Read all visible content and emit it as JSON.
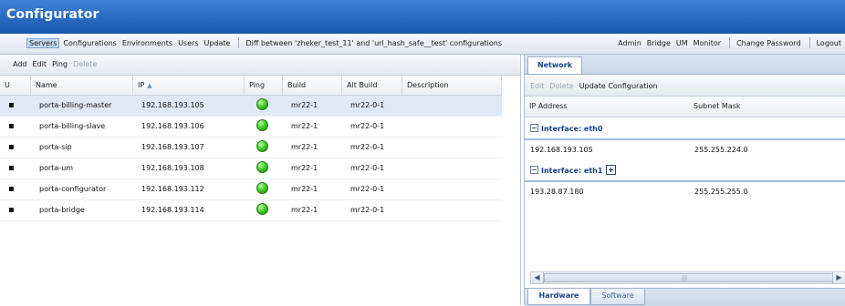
{
  "app": {
    "title": "Configurator"
  },
  "menu": {
    "left": [
      "Servers",
      "Configurations",
      "Environments",
      "Users",
      "Update"
    ],
    "diff": "Diff between 'zheker_test_11' and 'url_hash_safe__test' configurations",
    "right_group": [
      "Admin",
      "Bridge",
      "UM",
      "Monitor"
    ],
    "change_password": "Change Password",
    "logout": "Logout"
  },
  "servers_toolbar": {
    "add": "Add",
    "edit": "Edit",
    "ping": "Ping",
    "delete": "Delete"
  },
  "servers_table": {
    "headers": [
      "U",
      "Name",
      "IP",
      "Ping",
      "Build",
      "Alt Build",
      "Description"
    ],
    "rows": [
      {
        "u": "▪",
        "name": "porta-billing-master",
        "ip": "192.168.193.105",
        "ping": "ok",
        "build": "mr22-1",
        "alt_build": "mr22-0-1",
        "description": ""
      },
      {
        "u": "▪",
        "name": "porta-billing-slave",
        "ip": "192.168.193.106",
        "ping": "ok",
        "build": "mr22-1",
        "alt_build": "mr22-0-1",
        "description": ""
      },
      {
        "u": "▪",
        "name": "porta-sip",
        "ip": "192.168.193.107",
        "ping": "ok",
        "build": "mr22-1",
        "alt_build": "mr22-0-1",
        "description": ""
      },
      {
        "u": "▪",
        "name": "porta-um",
        "ip": "192.168.193.108",
        "ping": "ok",
        "build": "mr22-1",
        "alt_build": "mr22-0-1",
        "description": ""
      },
      {
        "u": "▪",
        "name": "porta-configurator",
        "ip": "192.168.193.112",
        "ping": "ok",
        "build": "mr22-1",
        "alt_build": "mr22-0-1",
        "description": ""
      },
      {
        "u": "▪",
        "name": "porta-bridge",
        "ip": "192.168.193.114",
        "ping": "ok",
        "build": "mr22-1",
        "alt_build": "mr22-0-1",
        "description": ""
      }
    ]
  },
  "network": {
    "tab": "Network",
    "toolbar": {
      "edit": "Edit",
      "delete": "Delete",
      "update": "Update Configuration"
    },
    "headers": [
      "IP Address",
      "Subnet Mask"
    ],
    "interfaces": [
      {
        "label": "Interface: eth0",
        "ip": "192.168.193.105",
        "mask": "255.255.224.0"
      },
      {
        "label": "Interface: eth1",
        "ip": "193.28.87.180",
        "mask": "255.255.255.0"
      }
    ]
  },
  "bottom_tabs": {
    "hardware": "Hardware",
    "software": "Software"
  },
  "colors": {
    "title_bar": "#1f63bf",
    "ping_ok": "#34c21d",
    "group_label": "#15428b"
  }
}
